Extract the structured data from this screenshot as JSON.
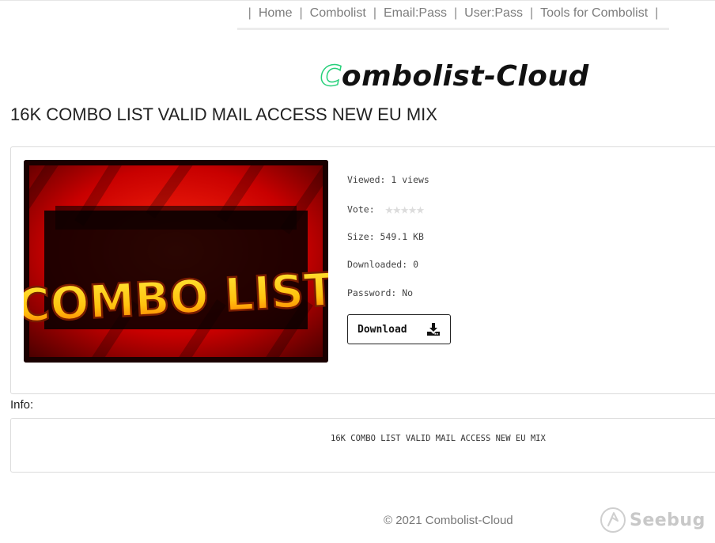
{
  "nav": {
    "separator": "|",
    "items": [
      {
        "label": "Home"
      },
      {
        "label": "Combolist"
      },
      {
        "label": "Email:Pass"
      },
      {
        "label": "User:Pass"
      },
      {
        "label": "Tools for Combolist"
      }
    ]
  },
  "logo": {
    "first_letter": "C",
    "rest": "ombolist-Cloud"
  },
  "post": {
    "title": "16K COMBO LIST VALID MAIL ACCESS NEW EU MIX",
    "thumbnail_text": "COMBO LIST",
    "viewed": "Viewed: 1 views",
    "vote_label": "Vote:",
    "rating": 0,
    "rating_max": 5,
    "size": "Size: 549.1 KB",
    "downloaded": "Downloaded: 0",
    "password": "Password: No",
    "download_label": "Download"
  },
  "info": {
    "label": "Info:",
    "text": "16K COMBO LIST VALID MAIL ACCESS NEW EU MIX"
  },
  "footer": {
    "copyright": "© 2021 Combolist-Cloud"
  },
  "watermark": {
    "text": "Seebug"
  },
  "colors": {
    "logo_accent": "#27d07a",
    "thumb_red": "#d40000",
    "thumb_text": "#ffd21a"
  }
}
